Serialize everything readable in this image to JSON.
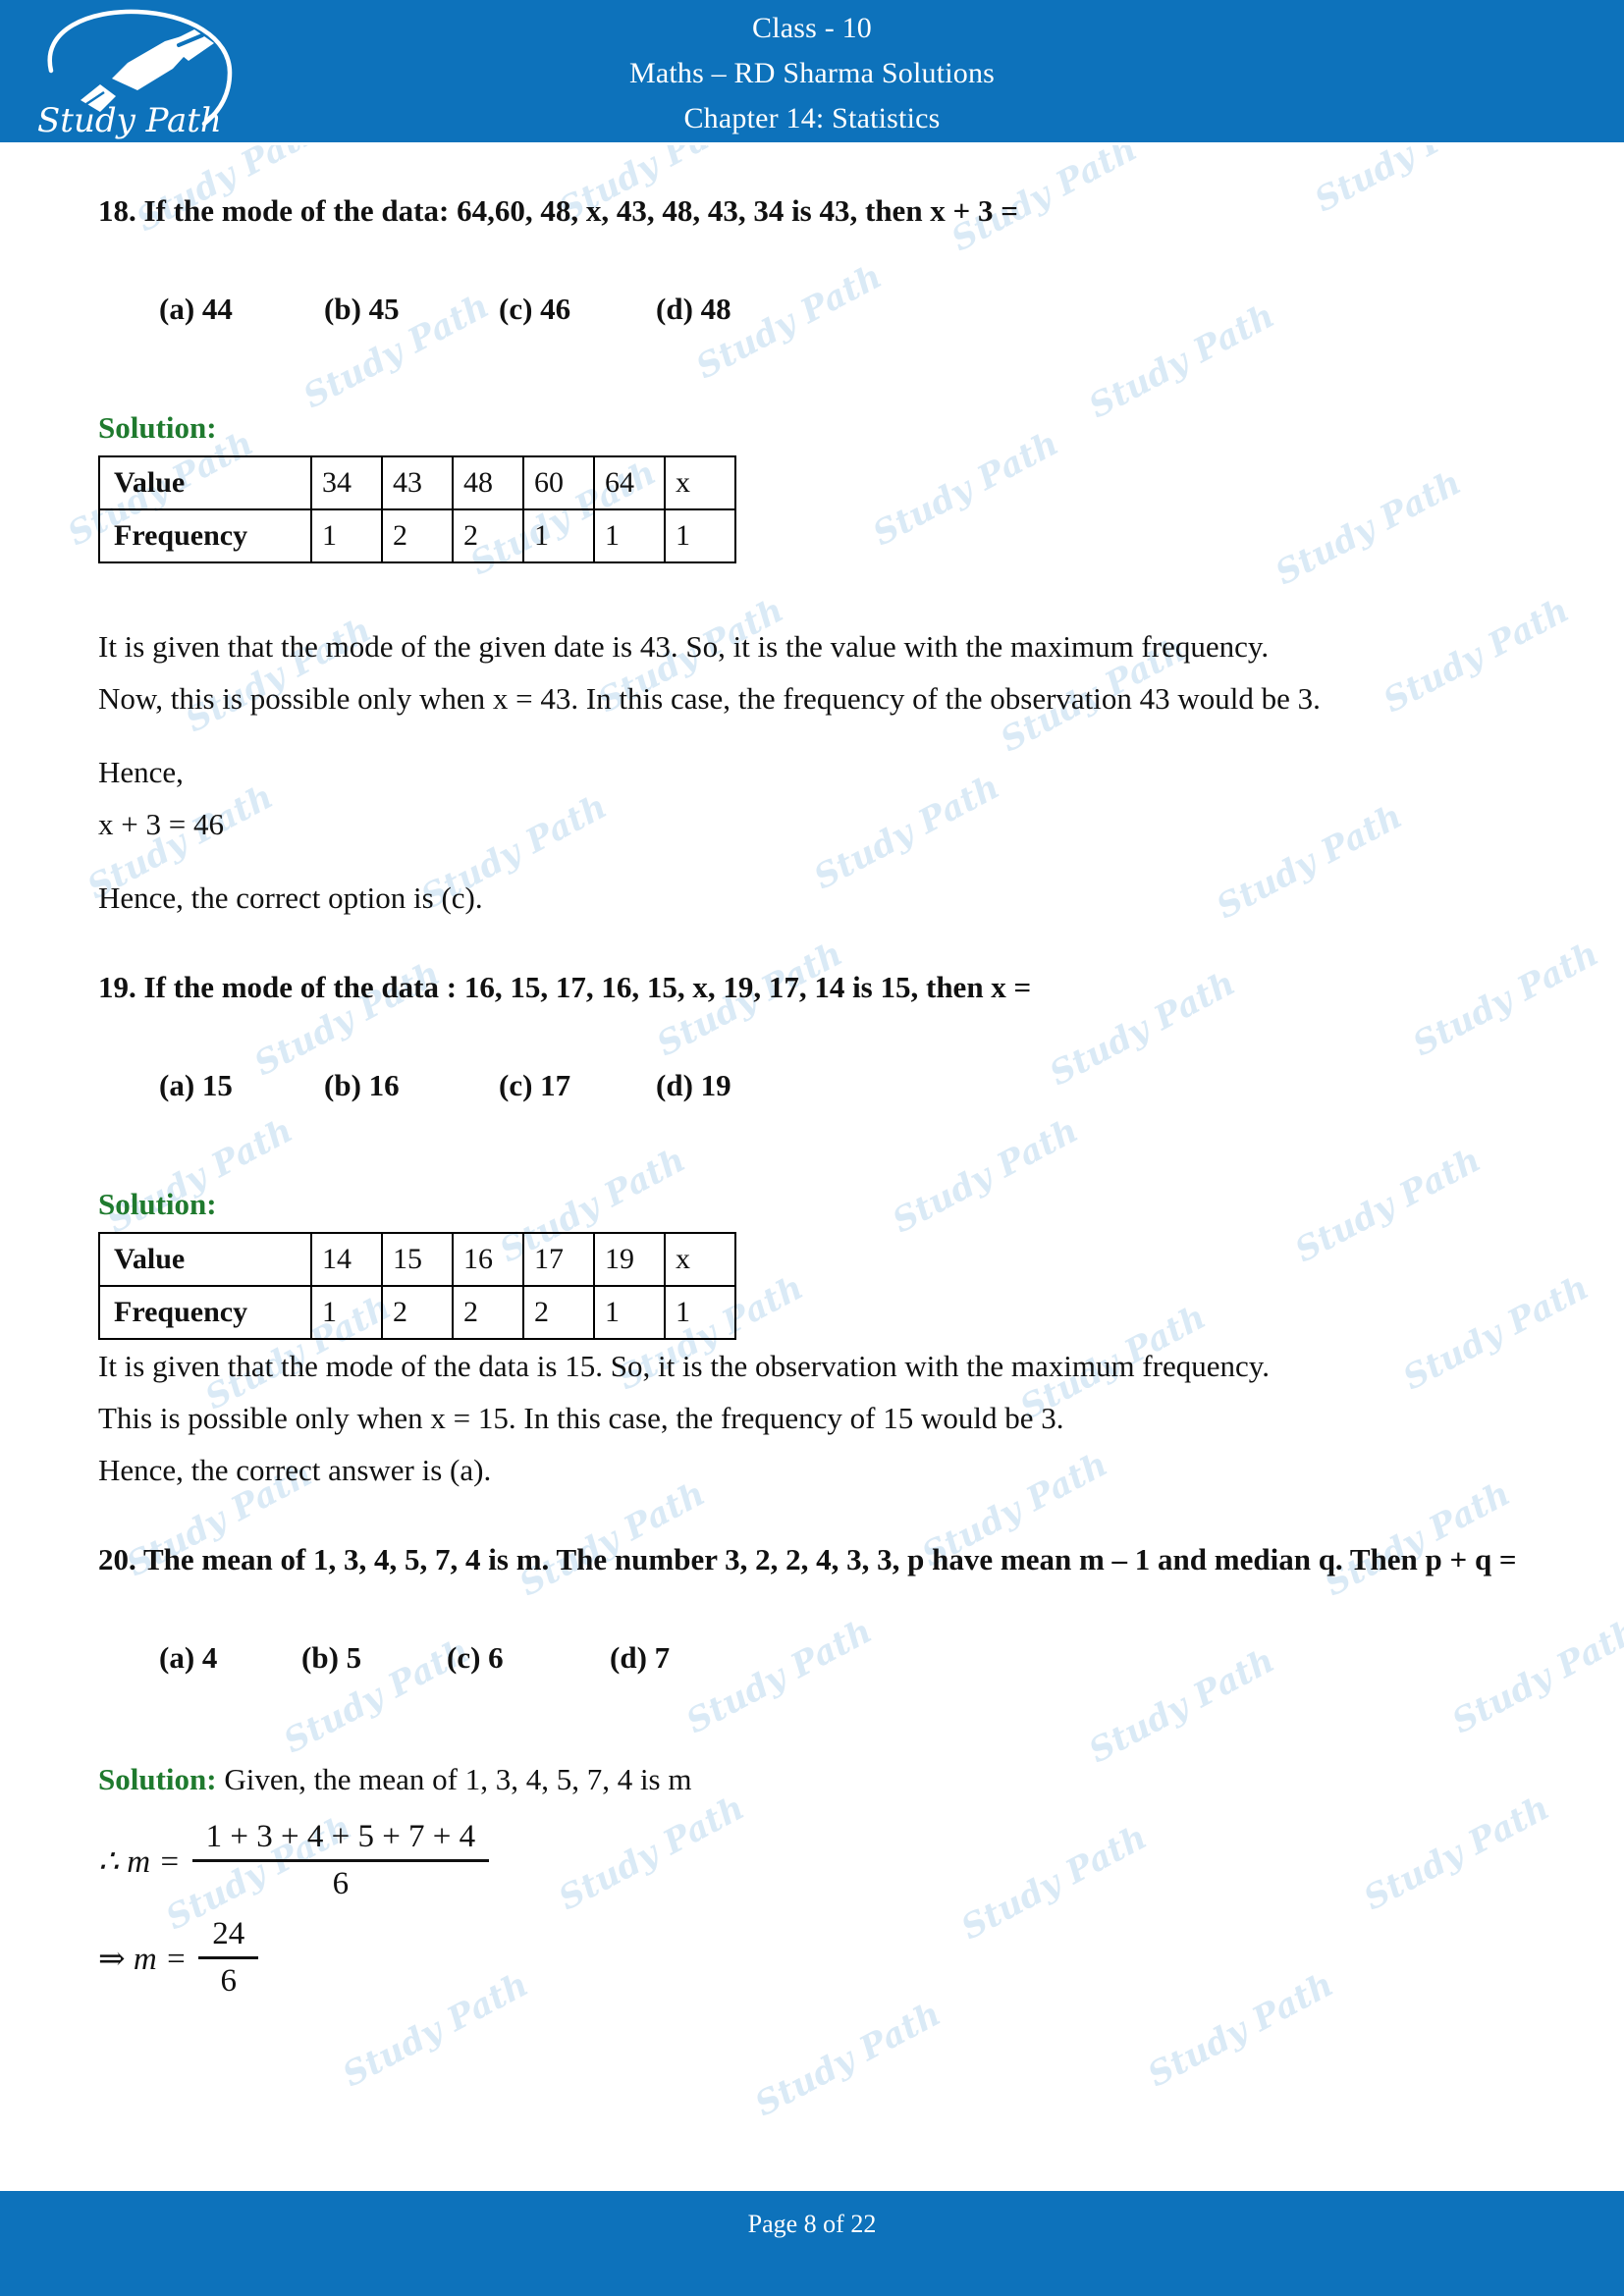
{
  "header": {
    "logo_text": "Study Path",
    "logo_icon": "fountain-pen-icon",
    "line1": "Class - 10",
    "line2": "Maths – RD Sharma Solutions",
    "line3": "Chapter 14: Statistics",
    "background_color": "#0d72bb"
  },
  "watermark": {
    "text": "Study Path",
    "color": "#bcd9ef"
  },
  "solution_label": "Solution:",
  "solution_label_color": "#1f7a2e",
  "questions": [
    {
      "number": "18.",
      "prompt": "If the mode of the data: 64,60, 48, x, 43, 48, 43, 34 is 43, then x + 3 =",
      "options": [
        "(a) 44",
        "(b) 45",
        "(c) 46",
        "(d) 48"
      ],
      "table": {
        "row_labels": [
          "Value",
          "Frequency"
        ],
        "values": [
          "34",
          "43",
          "48",
          "60",
          "64",
          "x"
        ],
        "frequencies": [
          "1",
          "2",
          "2",
          "1",
          "1",
          "1"
        ]
      },
      "paragraphs": [
        "It is given that the mode of the given date is 43. So, it is the value with the maximum frequency.",
        "Now, this is possible only when x = 43. In this case, the frequency of the observation 43 would be 3."
      ],
      "hence_label": "Hence,",
      "hence_eq": "x + 3 = 46",
      "conclusion": "Hence, the correct option is (c)."
    },
    {
      "number": "19.",
      "prompt": "If the mode of the data : 16, 15, 17, 16, 15, x, 19, 17, 14 is 15, then x =",
      "options": [
        "(a) 15",
        "(b) 16",
        "(c) 17",
        "(d) 19"
      ],
      "table": {
        "row_labels": [
          "Value",
          "Frequency"
        ],
        "values": [
          "14",
          "15",
          "16",
          "17",
          "19",
          "x"
        ],
        "frequencies": [
          "1",
          "2",
          "2",
          "2",
          "1",
          "1"
        ]
      },
      "paragraphs": [
        "It is given that the mode of the data is 15. So, it is the observation with the maximum frequency.",
        "This is possible only when x = 15. In this case, the frequency of 15 would be 3."
      ],
      "conclusion": "Hence, the correct answer is (a)."
    },
    {
      "number": "20.",
      "prompt": "The mean of 1, 3, 4, 5, 7, 4 is m. The number 3, 2, 2, 4, 3, 3, p have mean m – 1 and median q. Then p + q =",
      "options": [
        "(a) 4",
        "(b) 5",
        "(c) 6",
        "(d) 7"
      ],
      "solution_intro": "Given, the mean of 1, 3, 4, 5, 7, 4 is m",
      "equations": [
        {
          "lead": "∴ m =",
          "numerator": "1 + 3 + 4 + 5 + 7 + 4",
          "denominator": "6"
        },
        {
          "lead": "⇒ m =",
          "numerator": "24",
          "denominator": "6"
        }
      ]
    }
  ],
  "footer": {
    "text": "Page 8 of 22",
    "background_color": "#0d72bb"
  }
}
